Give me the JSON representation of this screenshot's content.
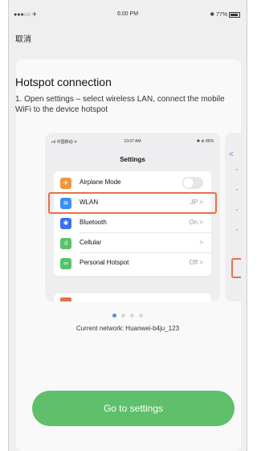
{
  "status": {
    "carrier": "●●●○○ ✈",
    "time": "6:00 PM",
    "battery_text": "✱ 77%"
  },
  "nav": {
    "cancel": "取消"
  },
  "card": {
    "title": "Hotspot connection",
    "description": "1. Open settings – select wireless LAN, connect the mobile WiFi to the device hotspot"
  },
  "phone": {
    "carrier": "ıııl 中国移动 ✈",
    "time": "10:07 AM",
    "battery": "✱ ⊕ 85%",
    "header": "Settings",
    "rows": [
      {
        "label": "Airplane Mode",
        "value": "",
        "icon": "airplane-icon",
        "color": "#f0963a",
        "glyph": "✈"
      },
      {
        "label": "WLAN",
        "value": "JP  >",
        "icon": "wifi-icon",
        "color": "#3d8ef0",
        "glyph": "≋"
      },
      {
        "label": "Bluetooth",
        "value": "On  >",
        "icon": "bluetooth-icon",
        "color": "#3d6ef0",
        "glyph": "✱"
      },
      {
        "label": "Cellular",
        "value": ">",
        "icon": "cellular-icon",
        "color": "#57c26b",
        "glyph": "ıl"
      },
      {
        "label": "Personal Hotspot",
        "value": "Off  >",
        "icon": "hotspot-icon",
        "color": "#57c26b",
        "glyph": "∞"
      }
    ]
  },
  "peek": {
    "back": "<"
  },
  "pagination": {
    "active": 0,
    "count": 4
  },
  "network": {
    "text": "Current network: Huanwei-b4ju_123"
  },
  "button": {
    "label": "Go to settings"
  },
  "colors": {
    "accent_green": "#5fbf6a",
    "highlight": "#e8704a",
    "link_blue": "#4a90e2"
  }
}
